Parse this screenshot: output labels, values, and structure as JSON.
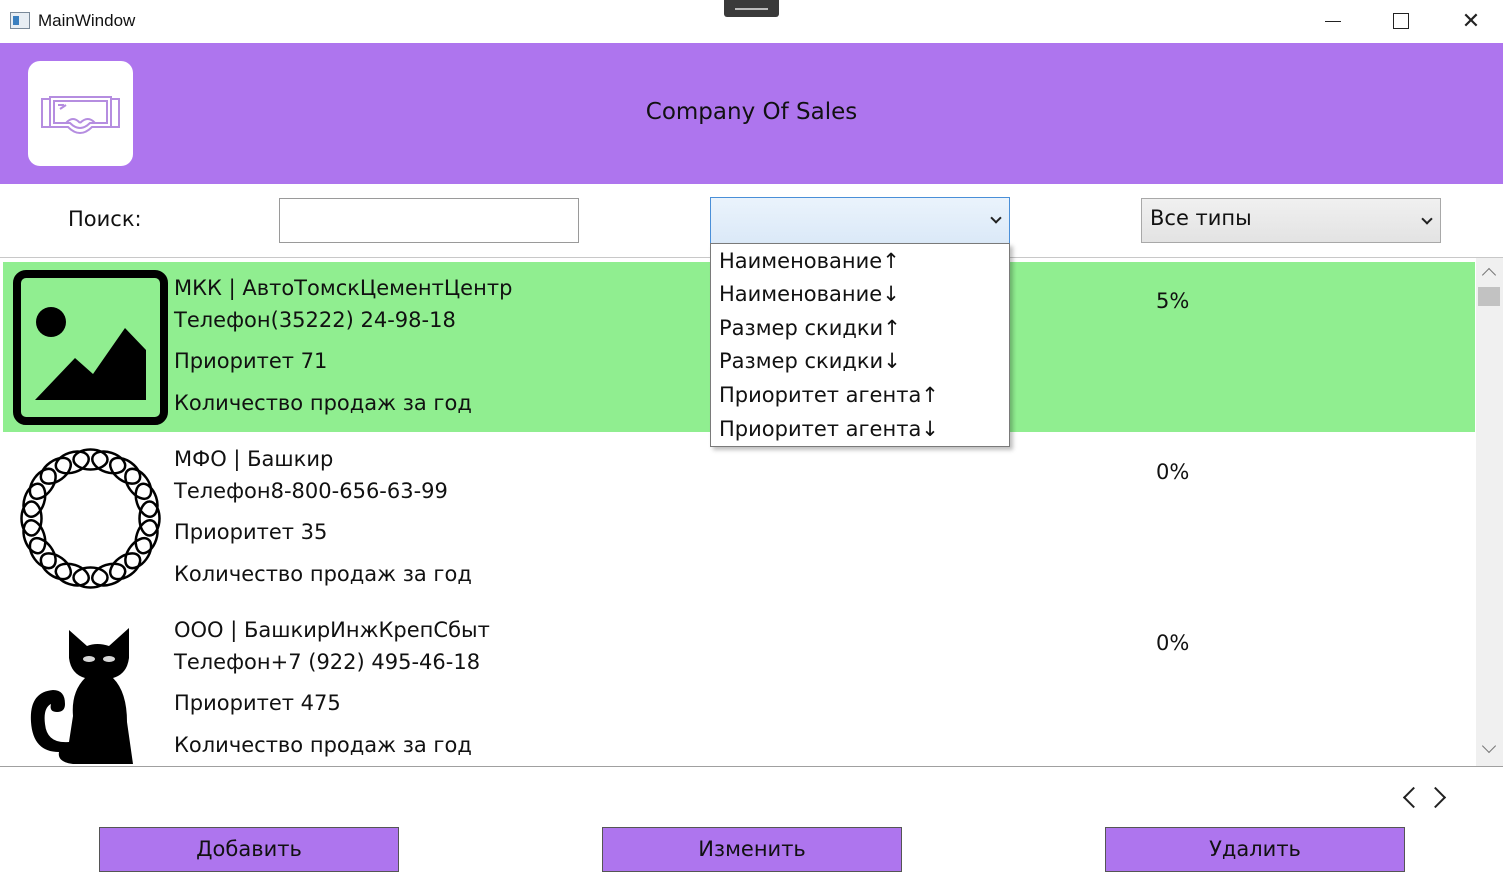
{
  "window": {
    "title": "MainWindow"
  },
  "header": {
    "company": "Company Of Sales",
    "logo_icon": "vr-goggles-icon"
  },
  "filters": {
    "search_label": "Поиск:",
    "search_value": "",
    "sort_selected": "",
    "type_selected": "Все типы"
  },
  "sort_options": [
    "Наименование↑",
    "Наименование↓",
    "Размер скидки↑",
    "Размер скидки↓",
    "Приоритет агента↑",
    "Приоритет агента↓"
  ],
  "agents": [
    {
      "title": "МКК | АвтоТомскЦементЦентр",
      "phone": "Телефон(35222) 24-98-18",
      "priority": "Приоритет 71",
      "sales": "Количество продаж за год",
      "discount": "5%",
      "image_icon": "image-placeholder-icon",
      "selected": true
    },
    {
      "title": "МФО | Башкир",
      "phone": "Телефон8-800-656-63-99",
      "priority": "Приоритет 35",
      "sales": "Количество продаж за год",
      "discount": "0%",
      "image_icon": "coil-ring-icon",
      "selected": false
    },
    {
      "title": "ООО | БашкирИнжКрепСбыт",
      "phone": "Телефон+7 (922) 495-46-18",
      "priority": "Приоритет 475",
      "sales": "Количество продаж за год",
      "discount": "0%",
      "image_icon": "black-cat-icon",
      "selected": false
    }
  ],
  "pager": {
    "prev_icon": "chevron-left-icon",
    "next_icon": "chevron-right-icon"
  },
  "actions": {
    "add": "Добавить",
    "edit": "Изменить",
    "delete": "Удалить"
  },
  "colors": {
    "accent": "#ae75ee",
    "selected_row": "#90ee90"
  }
}
